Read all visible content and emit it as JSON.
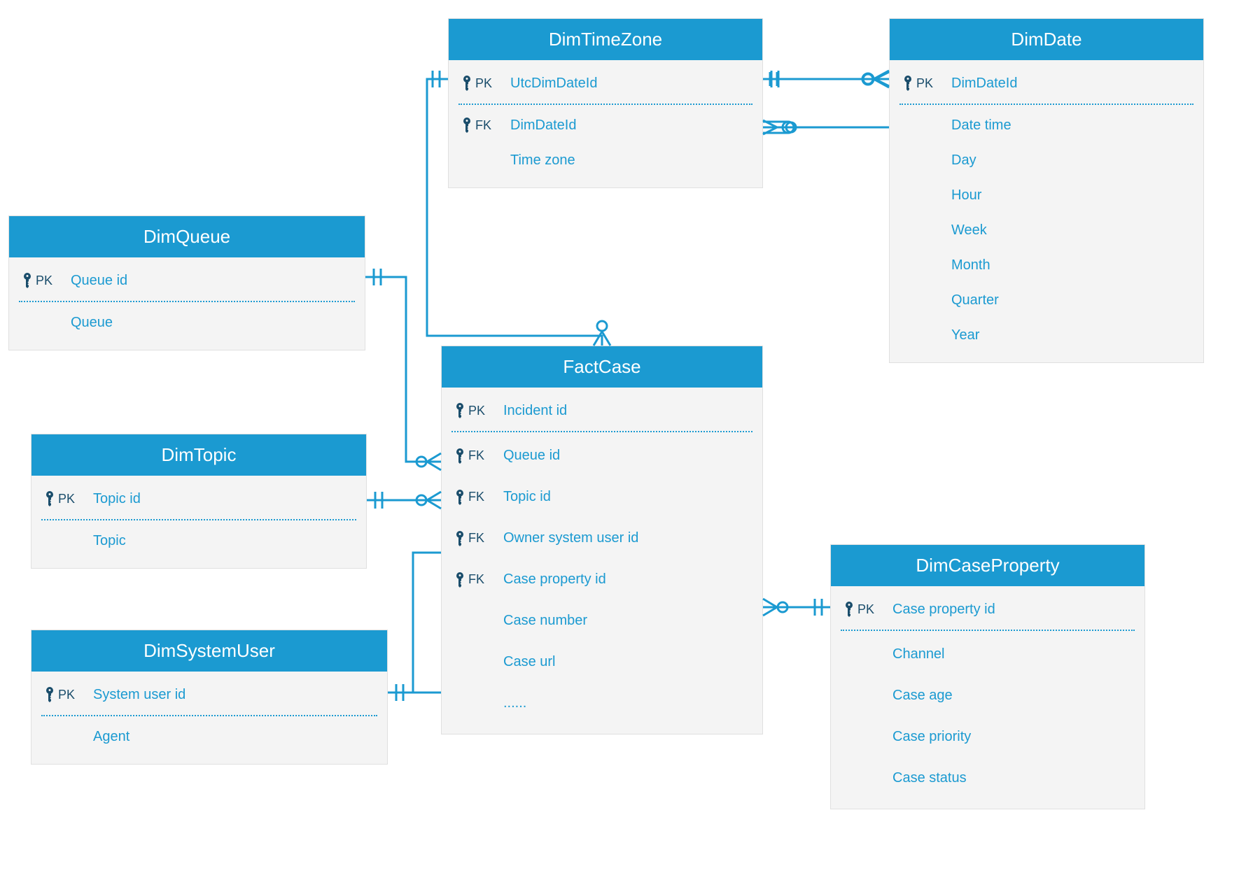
{
  "entities": {
    "dimTimeZone": {
      "title": "DimTimeZone",
      "fields": [
        {
          "key": "PK",
          "name": "UtcDimDateId"
        },
        {
          "key": "FK",
          "name": "DimDateId"
        },
        {
          "key": "",
          "name": "Time zone"
        }
      ]
    },
    "dimDate": {
      "title": "DimDate",
      "fields": [
        {
          "key": "PK",
          "name": "DimDateId"
        },
        {
          "key": "",
          "name": "Date time"
        },
        {
          "key": "",
          "name": "Day"
        },
        {
          "key": "",
          "name": "Hour"
        },
        {
          "key": "",
          "name": "Week"
        },
        {
          "key": "",
          "name": "Month"
        },
        {
          "key": "",
          "name": "Quarter"
        },
        {
          "key": "",
          "name": "Year"
        }
      ]
    },
    "dimQueue": {
      "title": "DimQueue",
      "fields": [
        {
          "key": "PK",
          "name": "Queue id"
        },
        {
          "key": "",
          "name": "Queue"
        }
      ]
    },
    "dimTopic": {
      "title": "DimTopic",
      "fields": [
        {
          "key": "PK",
          "name": "Topic id"
        },
        {
          "key": "",
          "name": "Topic"
        }
      ]
    },
    "dimSystemUser": {
      "title": "DimSystemUser",
      "fields": [
        {
          "key": "PK",
          "name": "System user id"
        },
        {
          "key": "",
          "name": "Agent"
        }
      ]
    },
    "factCase": {
      "title": "FactCase",
      "fields": [
        {
          "key": "PK",
          "name": "Incident id"
        },
        {
          "key": "FK",
          "name": "Queue id"
        },
        {
          "key": "FK",
          "name": "Topic id"
        },
        {
          "key": "FK",
          "name": "Owner system user id"
        },
        {
          "key": "FK",
          "name": "Case property id"
        },
        {
          "key": "",
          "name": "Case number"
        },
        {
          "key": "",
          "name": "Case url"
        },
        {
          "key": "",
          "name": "......"
        }
      ]
    },
    "dimCaseProperty": {
      "title": "DimCaseProperty",
      "fields": [
        {
          "key": "PK",
          "name": "Case property id"
        },
        {
          "key": "",
          "name": "Channel"
        },
        {
          "key": "",
          "name": "Case age"
        },
        {
          "key": "",
          "name": "Case priority"
        },
        {
          "key": "",
          "name": "Case status"
        }
      ]
    }
  }
}
